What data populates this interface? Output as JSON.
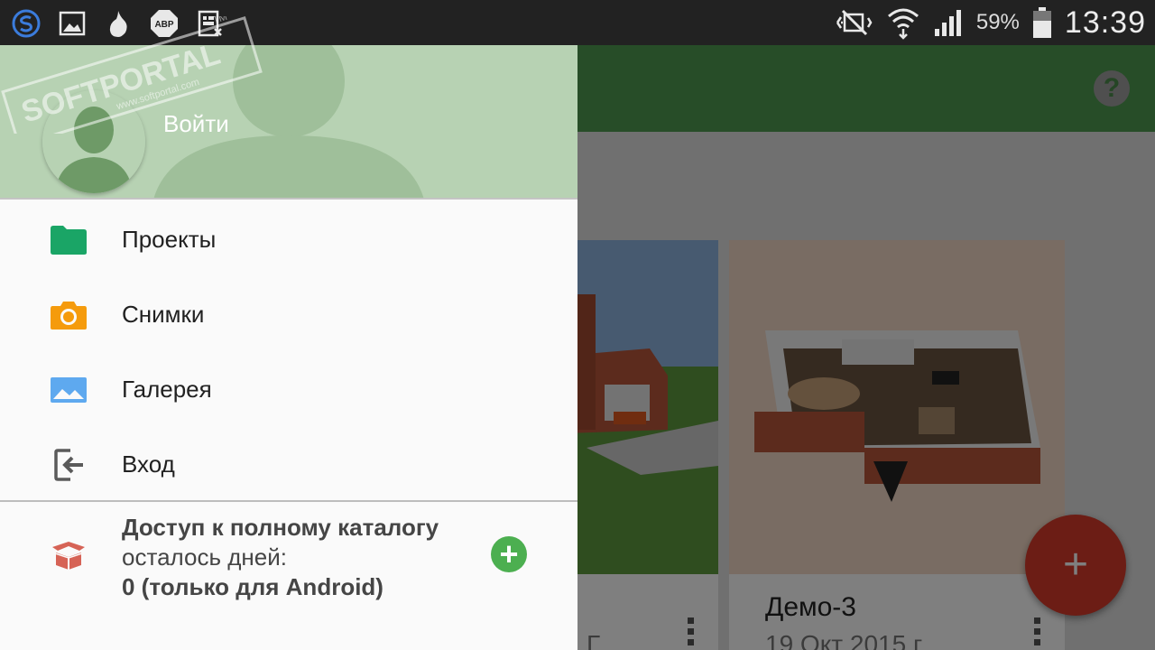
{
  "status_bar": {
    "battery_percent": "59%",
    "time": "13:39",
    "icons": [
      "s-shield-icon",
      "image-icon",
      "onion-icon",
      "abp-icon",
      "notes-icon",
      "mute-icon",
      "wifi-icon",
      "signal-icon",
      "battery-icon"
    ]
  },
  "watermark": {
    "brand": "SOFTPORTAL",
    "url": "www.softportal.com",
    "tm": "TM"
  },
  "drawer": {
    "header": {
      "login_label": "Войти"
    },
    "items": [
      {
        "label": "Проекты",
        "icon": "folder-icon"
      },
      {
        "label": "Снимки",
        "icon": "camera-icon"
      },
      {
        "label": "Галерея",
        "icon": "gallery-icon"
      },
      {
        "label": "Вход",
        "icon": "login-icon"
      }
    ],
    "promo": {
      "title": "Доступ к полному каталогу",
      "subtitle": "осталось дней:",
      "value": "0 (только для Android)",
      "icon": "box-icon",
      "add_icon": "plus-icon"
    }
  },
  "background_app": {
    "cards": [
      {
        "title": "",
        "date": "Г"
      },
      {
        "title": "Демо-3",
        "date": "19 Окт 2015 г."
      }
    ],
    "fab_label": "+",
    "help_label": "?"
  },
  "colors": {
    "toolbar": "#4f9a51",
    "drawer_header": "#b7d2b3",
    "fab": "#d83a2a",
    "folder": "#1aa566",
    "camera": "#f59b0c",
    "gallery": "#5ea9ef",
    "promo_add": "#4caf50"
  }
}
